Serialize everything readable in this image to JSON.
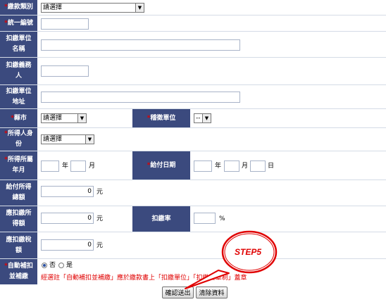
{
  "form": {
    "payment_type": {
      "label": "繳款類別",
      "value": "請選擇"
    },
    "tax_id": {
      "label": "統一編號",
      "value": ""
    },
    "withholder_name": {
      "label": "扣繳單位名稱",
      "value": ""
    },
    "withholder_person": {
      "label": "扣繳義務人",
      "value": ""
    },
    "withholder_address": {
      "label": "扣繳單位地址",
      "value": ""
    },
    "city": {
      "label": "縣市",
      "value": "請選擇"
    },
    "tax_office": {
      "label": "稽徵單位",
      "value": "--"
    },
    "income_identity": {
      "label": "所得人身份",
      "value": "請選擇"
    },
    "income_period": {
      "label": "所得所屬年月",
      "year_unit": "年",
      "month_unit": "月",
      "year": "",
      "month": ""
    },
    "payment_date": {
      "label": "給付日期",
      "year_unit": "年",
      "month_unit": "月",
      "day_unit": "日"
    },
    "total_income": {
      "label": "給付所得總額",
      "value": "0",
      "unit": "元"
    },
    "withholding_income": {
      "label": "應扣繳所得額",
      "value": "0",
      "unit": "元"
    },
    "withholding_rate": {
      "label": "扣繳率",
      "value": "",
      "unit": "%"
    },
    "withholding_tax": {
      "label": "應扣繳稅額",
      "value": "0",
      "unit": "元"
    },
    "auto_supplement": {
      "label": "自動補扣並補繳",
      "option_no": "否",
      "option_yes": "是",
      "selected": "否"
    },
    "note": "經選註「自動補扣並補繳」應於繳款書上「扣繳單位」「扣繳查章制」蓋章"
  },
  "buttons": {
    "submit": "確認送出",
    "clear": "清除資料"
  },
  "annotation": {
    "label": "STEP5",
    "color": "#e00000"
  },
  "colors": {
    "label_bg": "#3b4a7e",
    "required": "#e00000",
    "annotation": "#e00000"
  }
}
